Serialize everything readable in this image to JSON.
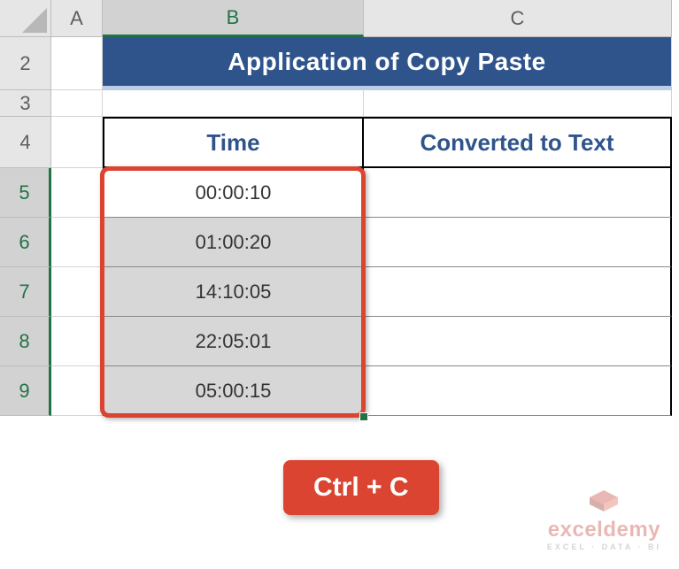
{
  "columns": [
    "A",
    "B",
    "C"
  ],
  "rows": [
    "2",
    "3",
    "4",
    "5",
    "6",
    "7",
    "8",
    "9"
  ],
  "title": "Application of Copy Paste",
  "headers": {
    "col_b": "Time",
    "col_c": "Converted to Text"
  },
  "chart_data": {
    "type": "table",
    "title": "Application of Copy Paste",
    "columns": [
      "Time",
      "Converted to Text"
    ],
    "rows": [
      [
        "00:00:10",
        ""
      ],
      [
        "01:00:20",
        ""
      ],
      [
        "14:10:05",
        ""
      ],
      [
        "22:05:01",
        ""
      ],
      [
        "05:00:15",
        ""
      ]
    ]
  },
  "keyhint": "Ctrl + C",
  "watermark": {
    "brand": "exceldemy",
    "tag": "EXCEL · DATA · BI"
  },
  "selection": {
    "range": "B5:B9"
  }
}
